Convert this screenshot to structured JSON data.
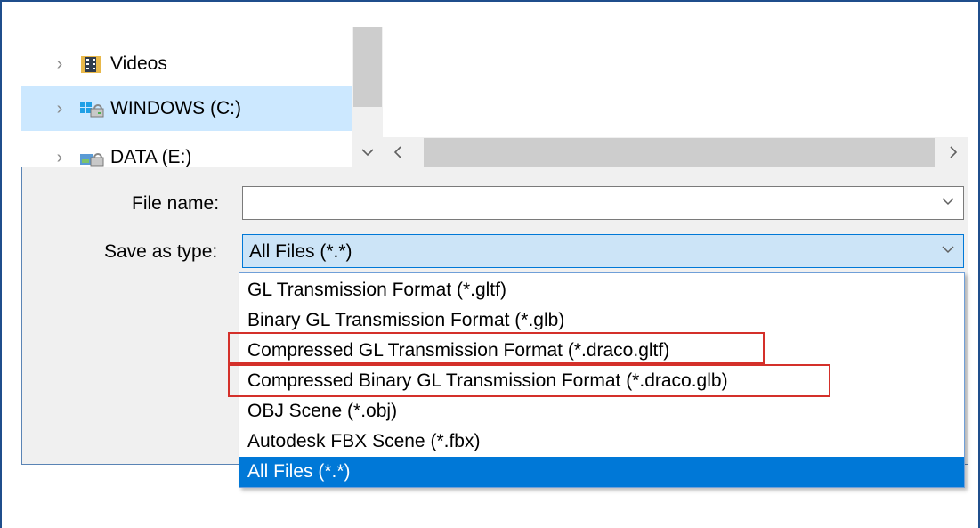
{
  "tree": {
    "items": [
      {
        "label": "Videos",
        "icon": "videos-folder-icon",
        "selected": false
      },
      {
        "label": "WINDOWS (C:)",
        "icon": "windows-drive-icon",
        "selected": true
      },
      {
        "label": "DATA (E:)",
        "icon": "drive-icon",
        "selected": false
      }
    ]
  },
  "form": {
    "file_name_label": "File name:",
    "file_name_value": "",
    "save_type_label": "Save as type:",
    "save_type_value": "All Files (*.*)"
  },
  "dropdown": {
    "options": [
      {
        "label": "GL Transmission Format (*.gltf)",
        "highlighted": false,
        "selected": false
      },
      {
        "label": "Binary GL Transmission Format (*.glb)",
        "highlighted": false,
        "selected": false
      },
      {
        "label": "Compressed GL Transmission Format (*.draco.gltf)",
        "highlighted": true,
        "selected": false
      },
      {
        "label": "Compressed Binary GL Transmission Format (*.draco.glb)",
        "highlighted": true,
        "selected": false
      },
      {
        "label": "OBJ Scene (*.obj)",
        "highlighted": false,
        "selected": false
      },
      {
        "label": "Autodesk FBX Scene (*.fbx)",
        "highlighted": false,
        "selected": false
      },
      {
        "label": "All Files (*.*)",
        "highlighted": false,
        "selected": true
      }
    ]
  },
  "colors": {
    "accent": "#0078d7",
    "selection_bg": "#cce8ff",
    "annotation_red": "#d4302a"
  }
}
